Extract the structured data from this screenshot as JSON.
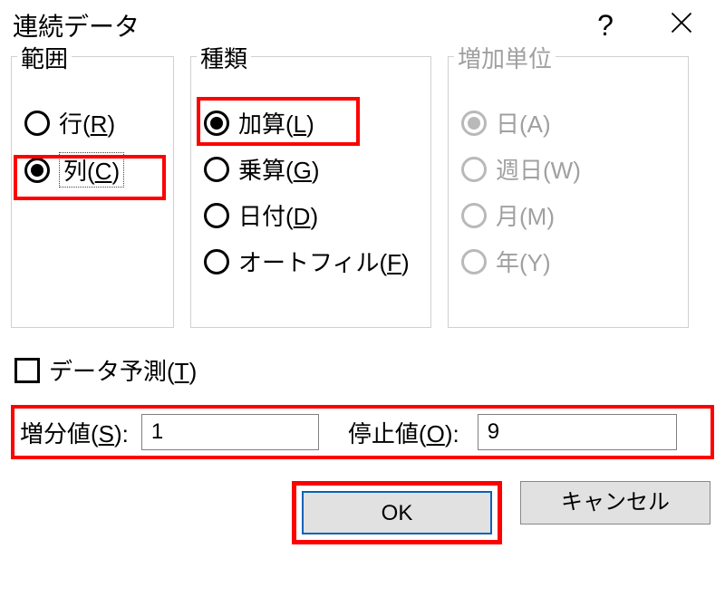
{
  "title": "連続データ",
  "groups": {
    "range": {
      "legend": "範囲",
      "options": [
        {
          "label_pre": "行(",
          "mnemonic": "R",
          "label_post": ")",
          "selected": false
        },
        {
          "label_pre": "列(",
          "mnemonic": "C",
          "label_post": ")",
          "selected": true
        }
      ]
    },
    "type": {
      "legend": "種類",
      "options": [
        {
          "label_pre": "加算(",
          "mnemonic": "L",
          "label_post": ")",
          "selected": true
        },
        {
          "label_pre": "乗算(",
          "mnemonic": "G",
          "label_post": ")",
          "selected": false
        },
        {
          "label_pre": "日付(",
          "mnemonic": "D",
          "label_post": ")",
          "selected": false
        },
        {
          "label_pre": "オートフィル(",
          "mnemonic": "F",
          "label_post": ")",
          "selected": false
        }
      ]
    },
    "unit": {
      "legend": "増加単位",
      "options": [
        {
          "label": "日(A)",
          "selected": true
        },
        {
          "label": "週日(W)",
          "selected": false
        },
        {
          "label": "月(M)",
          "selected": false
        },
        {
          "label": "年(Y)",
          "selected": false
        }
      ]
    }
  },
  "trend": {
    "label_pre": "データ予測(",
    "mnemonic": "T",
    "label_post": ")",
    "checked": false
  },
  "step": {
    "label_pre": "増分値(",
    "mnemonic": "S",
    "label_post": "):",
    "value": "1"
  },
  "stop": {
    "label_pre": "停止値(",
    "mnemonic": "O",
    "label_post": "):",
    "value": "9"
  },
  "buttons": {
    "ok": "OK",
    "cancel": "キャンセル"
  }
}
